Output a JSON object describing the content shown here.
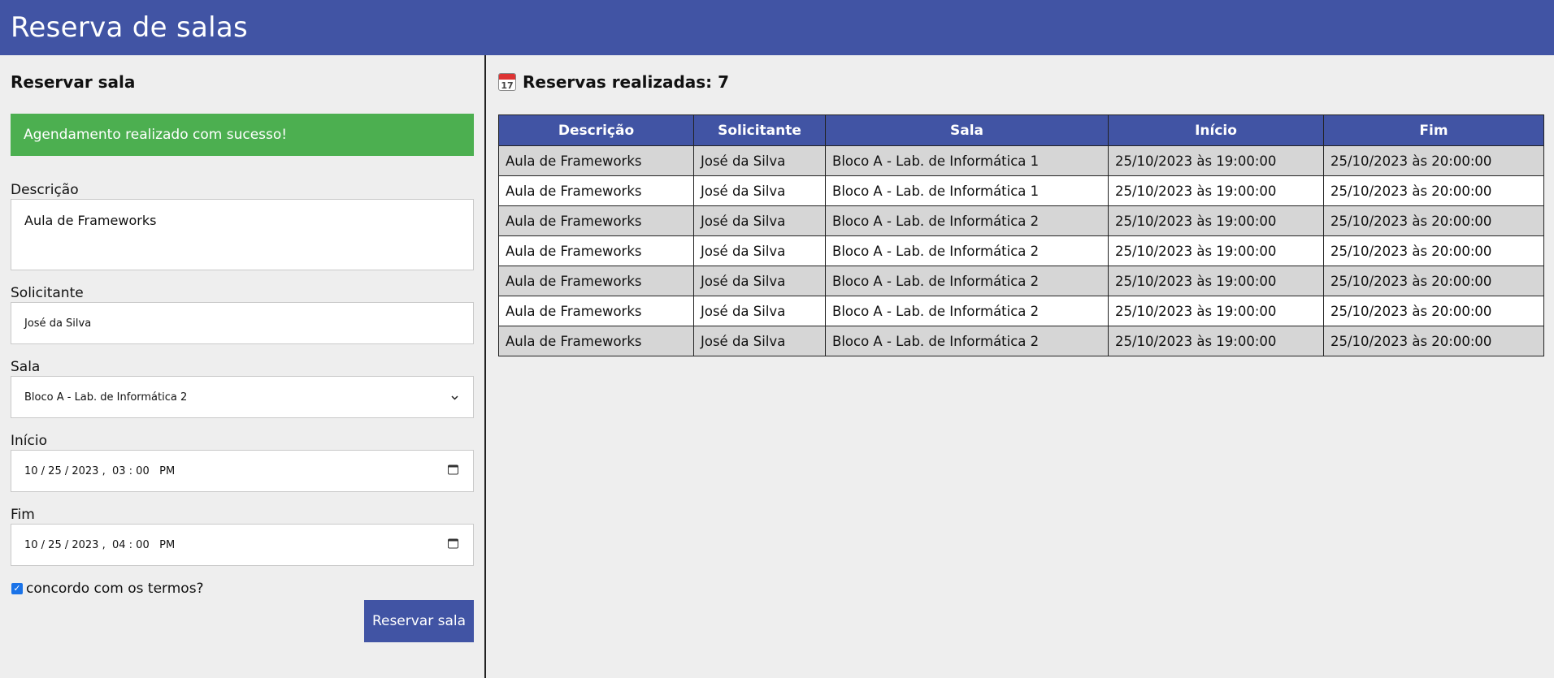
{
  "app": {
    "title": "Reserva de salas"
  },
  "form": {
    "title": "Reservar sala",
    "alert": "Agendamento realizado com sucesso!",
    "descricao_label": "Descrição",
    "descricao_value": "Aula de Frameworks",
    "solicitante_label": "Solicitante",
    "solicitante_value": "José da Silva",
    "sala_label": "Sala",
    "sala_value": "Bloco A - Lab. de Informática 2",
    "inicio_label": "Início",
    "inicio_value": "10 / 25 / 2023 ,  03 : 00   PM",
    "fim_label": "Fim",
    "fim_value": "10 / 25 / 2023 ,  04 : 00   PM",
    "termos_label": "concordo com os termos?",
    "termos_checked": true,
    "submit_label": "Reservar sala"
  },
  "reservas": {
    "title": "Reservas realizadas: 7",
    "calendar_day": "17",
    "icon": "calendar-icon",
    "columns": [
      "Descrição",
      "Solicitante",
      "Sala",
      "Início",
      "Fim"
    ],
    "rows": [
      [
        "Aula de Frameworks",
        "José da Silva",
        "Bloco A - Lab. de Informática 1",
        "25/10/2023 às 19:00:00",
        "25/10/2023 às 20:00:00"
      ],
      [
        "Aula de Frameworks",
        "José da Silva",
        "Bloco A - Lab. de Informática 1",
        "25/10/2023 às 19:00:00",
        "25/10/2023 às 20:00:00"
      ],
      [
        "Aula de Frameworks",
        "José da Silva",
        "Bloco A - Lab. de Informática 2",
        "25/10/2023 às 19:00:00",
        "25/10/2023 às 20:00:00"
      ],
      [
        "Aula de Frameworks",
        "José da Silva",
        "Bloco A - Lab. de Informática 2",
        "25/10/2023 às 19:00:00",
        "25/10/2023 às 20:00:00"
      ],
      [
        "Aula de Frameworks",
        "José da Silva",
        "Bloco A - Lab. de Informática 2",
        "25/10/2023 às 19:00:00",
        "25/10/2023 às 20:00:00"
      ],
      [
        "Aula de Frameworks",
        "José da Silva",
        "Bloco A - Lab. de Informática 2",
        "25/10/2023 às 19:00:00",
        "25/10/2023 às 20:00:00"
      ],
      [
        "Aula de Frameworks",
        "José da Silva",
        "Bloco A - Lab. de Informática 2",
        "25/10/2023 às 19:00:00",
        "25/10/2023 às 20:00:00"
      ]
    ]
  },
  "colors": {
    "primary": "#4154a4",
    "success": "#4caf50",
    "background": "#eeeeee",
    "row_alt": "#d6d6d6"
  }
}
